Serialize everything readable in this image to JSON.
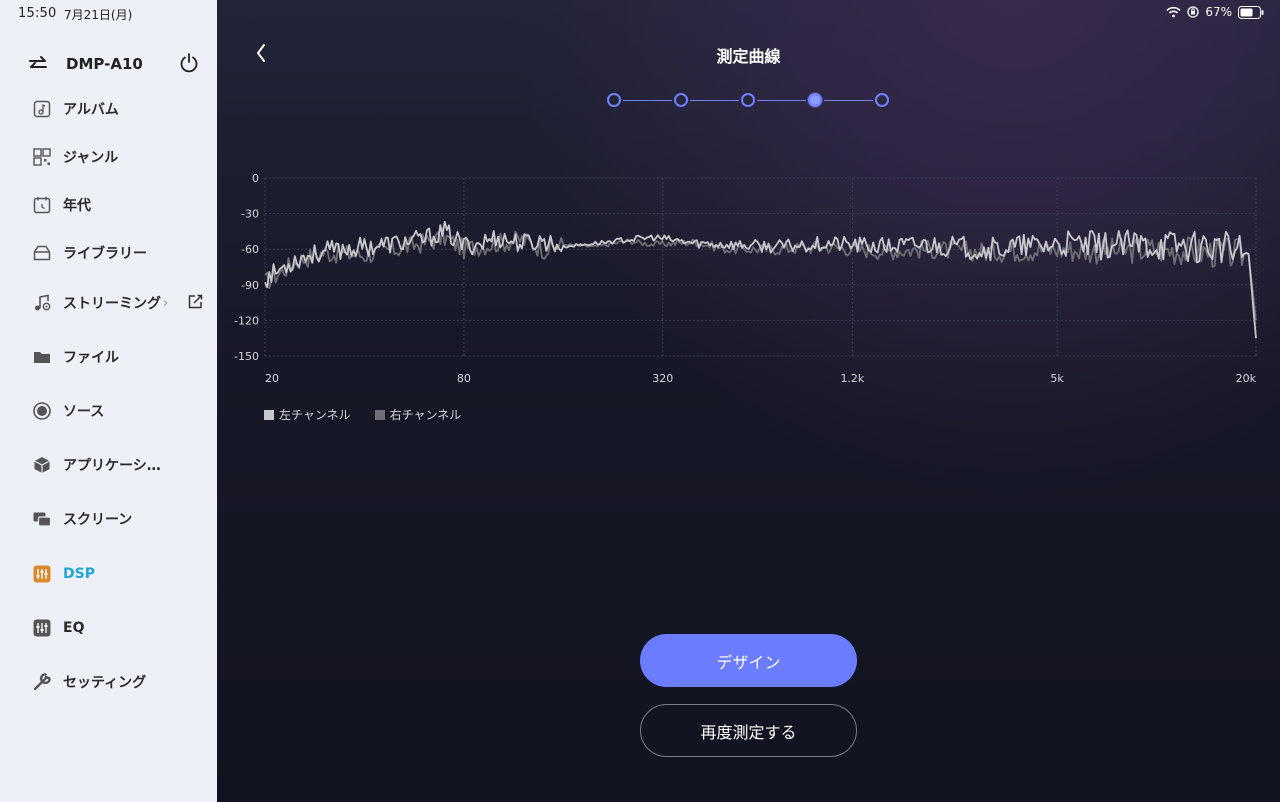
{
  "status_bar": {
    "time": "15:50",
    "date": "7月21日(月)",
    "battery": "67%"
  },
  "sidebar": {
    "device_name": "DMP-A10",
    "items": [
      {
        "label": "アルバム",
        "icon": "album-icon"
      },
      {
        "label": "ジャンル",
        "icon": "genre-icon"
      },
      {
        "label": "年代",
        "icon": "calendar-icon"
      },
      {
        "label": "ライブラリー",
        "icon": "library-icon"
      },
      {
        "label": "ストリーミング",
        "icon": "music-note-icon"
      },
      {
        "label": "ファイル",
        "icon": "folder-icon"
      },
      {
        "label": "ソース",
        "icon": "source-icon"
      },
      {
        "label": "アプリケーシ…",
        "icon": "app-icon"
      },
      {
        "label": "スクリーン",
        "icon": "screen-icon"
      },
      {
        "label": "DSP",
        "icon": "dsp-icon",
        "active": true
      },
      {
        "label": "EQ",
        "icon": "eq-icon"
      },
      {
        "label": "セッティング",
        "icon": "wrench-icon"
      }
    ],
    "streaming_chevron": "›"
  },
  "main": {
    "title": "測定曲線",
    "steps_total": 5,
    "current_step": 4,
    "design_button": "デザイン",
    "remeasure_button": "再度測定する"
  },
  "colors": {
    "accent": "#6b7cff",
    "active_nav": "#20a6d6",
    "left_channel": "#c8c8cc",
    "right_channel": "#6e6f76"
  },
  "chart_data": {
    "type": "line",
    "x_scale": "log",
    "x_ticks": [
      "20",
      "80",
      "320",
      "1.2k",
      "5k",
      "20k"
    ],
    "y_ticks": [
      "0",
      "-30",
      "-60",
      "-90",
      "-120",
      "-150"
    ],
    "ylim": [
      -150,
      0
    ],
    "grid": true,
    "legend_position": "bottom-left",
    "series": [
      {
        "name": "左チャンネル",
        "color": "#c8c8cc",
        "x": [
          20,
          25,
          30,
          40,
          50,
          60,
          70,
          80,
          90,
          100,
          120,
          140,
          160,
          200,
          250,
          300,
          400,
          500,
          700,
          1000,
          1500,
          2000,
          3000,
          5000,
          7000,
          10000,
          15000,
          19000,
          20000
        ],
        "y": [
          -85,
          -68,
          -62,
          -58,
          -55,
          -52,
          -45,
          -57,
          -55,
          -50,
          -55,
          -53,
          -58,
          -55,
          -52,
          -50,
          -55,
          -56,
          -58,
          -55,
          -58,
          -56,
          -60,
          -56,
          -57,
          -56,
          -58,
          -64,
          -135
        ]
      },
      {
        "name": "右チャンネル",
        "color": "#6e6f76",
        "x": [
          20,
          25,
          30,
          40,
          50,
          60,
          70,
          80,
          90,
          100,
          120,
          140,
          160,
          200,
          250,
          300,
          400,
          500,
          700,
          1000,
          1500,
          2000,
          3000,
          5000,
          7000,
          10000,
          15000,
          19000,
          20000
        ],
        "y": [
          -88,
          -70,
          -63,
          -65,
          -60,
          -55,
          -50,
          -60,
          -57,
          -55,
          -52,
          -60,
          -56,
          -58,
          -53,
          -56,
          -54,
          -60,
          -60,
          -58,
          -62,
          -60,
          -62,
          -60,
          -62,
          -60,
          -63,
          -65,
          -120
        ]
      }
    ]
  }
}
